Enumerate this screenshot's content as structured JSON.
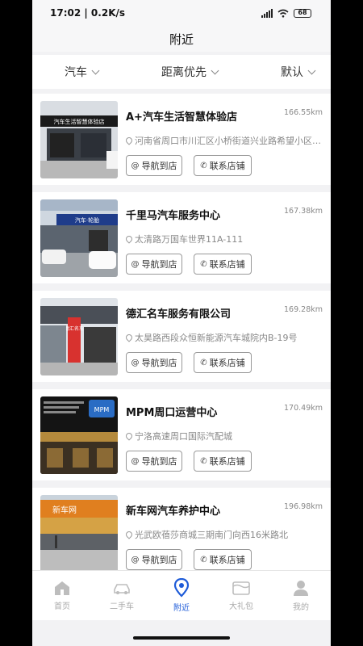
{
  "status": {
    "time": "17:02 | 0.2K/s",
    "battery": "68"
  },
  "title": "附近",
  "filters": [
    "汽车",
    "距离优先",
    "默认"
  ],
  "shops": [
    {
      "name": "A+汽车生活智慧体验店",
      "distance": "166.55km",
      "address": "河南省周口市川汇区小桥街道兴业路希望小区西南角",
      "nav_label": "导航到店",
      "call_label": "联系店铺",
      "photo_sign": "汽车生活智慧体验店"
    },
    {
      "name": "千里马汽车服务中心",
      "distance": "167.38km",
      "address": "太清路万国车世界11A-111",
      "nav_label": "导航到店",
      "call_label": "联系店铺",
      "photo_sign": "汽车·轮胎"
    },
    {
      "name": "德汇名车服务有限公司",
      "distance": "169.28km",
      "address": "太昊路西段众恒新能源汽车城院内B-19号",
      "nav_label": "导航到店",
      "call_label": "联系店铺",
      "photo_sign": "德汇名车"
    },
    {
      "name": "MPM周口运营中心",
      "distance": "170.49km",
      "address": "宁洛高速周口国际汽配城",
      "nav_label": "导航到店",
      "call_label": "联系店铺",
      "photo_sign": "MPM"
    },
    {
      "name": "新车网汽车养护中心",
      "distance": "196.98km",
      "address": "光武欧蓓莎商城三期南门向西16米路北",
      "nav_label": "导航到店",
      "call_label": "联系店铺",
      "photo_sign": "新车网"
    }
  ],
  "tabs": [
    {
      "label": "首页",
      "icon": "home-icon"
    },
    {
      "label": "二手车",
      "icon": "car-icon"
    },
    {
      "label": "附近",
      "icon": "location-icon",
      "active": true
    },
    {
      "label": "大礼包",
      "icon": "gift-icon"
    },
    {
      "label": "我的",
      "icon": "user-icon"
    }
  ],
  "colors": {
    "accent": "#1e5bd8",
    "inactive": "#aaaaaa"
  }
}
